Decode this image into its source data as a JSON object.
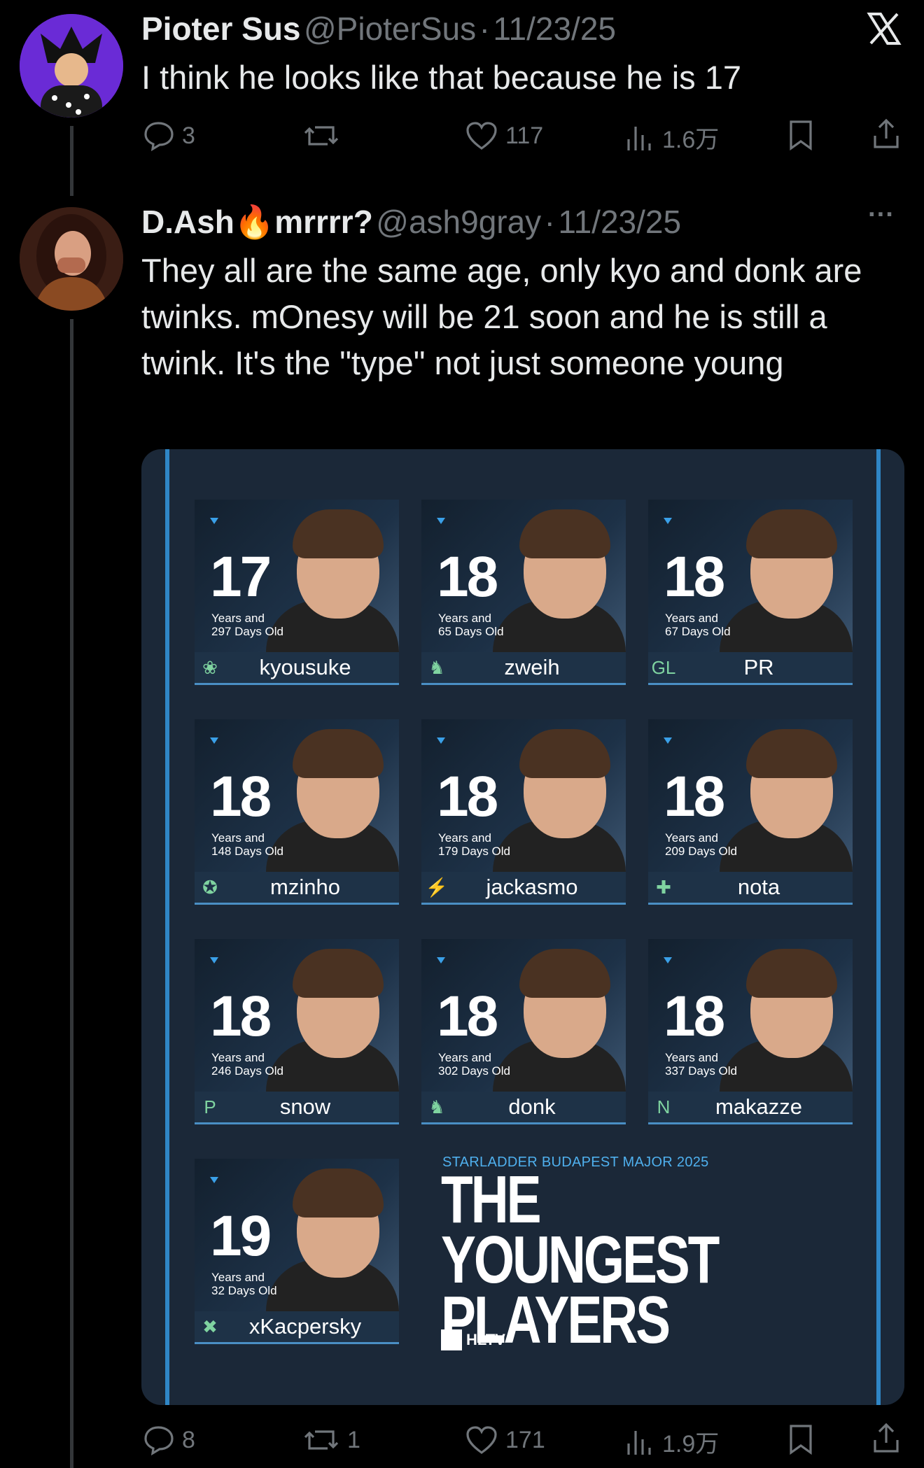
{
  "tweet1": {
    "name": "Pioter Sus",
    "handle": "@PioterSus",
    "date": "11/23/25",
    "text": "I think he looks like that because he is 17",
    "replies": "3",
    "reposts": "",
    "likes": "117",
    "views": "1.6万",
    "close_icon": "X"
  },
  "tweet2": {
    "name": "D.Ash",
    "name_emoji": "🔥",
    "name_suffix": "mrrrr?",
    "handle": "@ash9gray",
    "date": "11/23/25",
    "text": "They all are the same age, only kyo and donk are twinks. mOnesy will be 21 soon and he is still a twink. It's the \"type\" not just someone young",
    "replies": "8",
    "reposts": "1",
    "likes": "171",
    "views": "1.9万",
    "more_icon": "···"
  },
  "infographic": {
    "event": "STARLADDER BUDAPEST MAJOR 2025",
    "title_line1": "THE YOUNGEST",
    "title_line2": "PLAYERS",
    "brand": "HLTV",
    "players": [
      {
        "age": "17",
        "sub1": "Years and",
        "sub2": "297 Days Old",
        "name": "kyousuke"
      },
      {
        "age": "18",
        "sub1": "Years and",
        "sub2": "65 Days Old",
        "name": "zweih"
      },
      {
        "age": "18",
        "sub1": "Years and",
        "sub2": "67 Days Old",
        "name": "PR"
      },
      {
        "age": "18",
        "sub1": "Years and",
        "sub2": "148 Days Old",
        "name": "mzinho"
      },
      {
        "age": "18",
        "sub1": "Years and",
        "sub2": "179 Days Old",
        "name": "jackasmo"
      },
      {
        "age": "18",
        "sub1": "Years and",
        "sub2": "209 Days Old",
        "name": "nota"
      },
      {
        "age": "18",
        "sub1": "Years and",
        "sub2": "246 Days Old",
        "name": "snow"
      },
      {
        "age": "18",
        "sub1": "Years and",
        "sub2": "302 Days Old",
        "name": "donk"
      },
      {
        "age": "18",
        "sub1": "Years and",
        "sub2": "337 Days Old",
        "name": "makazze"
      },
      {
        "age": "19",
        "sub1": "Years and",
        "sub2": "32 Days Old",
        "name": "xKacpersky"
      }
    ]
  }
}
